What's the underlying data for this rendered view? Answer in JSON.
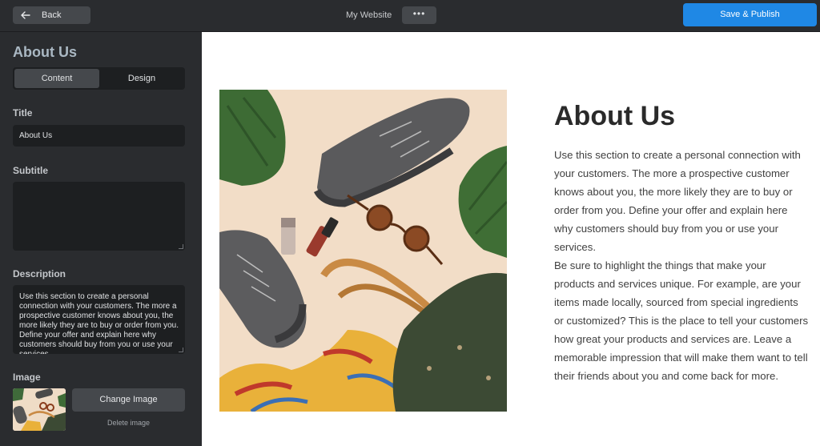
{
  "topbar": {
    "back_label": "Back",
    "site_title": "My Website",
    "more_glyph": "•••",
    "publish_label": "Save & Publish"
  },
  "sidebar": {
    "title": "About Us",
    "tabs": [
      {
        "label": "Content",
        "active": true
      },
      {
        "label": "Design",
        "active": false
      }
    ],
    "title_field": {
      "label": "Title",
      "value": "About Us"
    },
    "subtitle_field": {
      "label": "Subtitle",
      "value": ""
    },
    "description_field": {
      "label": "Description",
      "value": "Use this section to create a personal connection with your customers. The more a prospective customer knows about you, the more likely they are to buy or order from you. Define your offer and explain here why customers should buy from you or use your services."
    },
    "image_field": {
      "label": "Image",
      "change_label": "Change Image",
      "delete_label": "Delete image"
    }
  },
  "preview": {
    "heading": "About Us",
    "paragraphs": [
      "Use this section to create a personal connection with your customers. The more a prospective customer knows about you, the more likely they are to buy or order from you. Define your offer and explain here why customers should buy from you or use your services.",
      "Be sure to highlight the things that make your products and services unique. For example, are your items made locally, sourced from special ingredients or customized? This is the place to tell your customers how great your products and services are. Leave a memorable impression that will make them want to tell their friends about you and come back for more."
    ]
  },
  "icons": {
    "back": "arrow-left-icon",
    "more": "more-dots-icon"
  },
  "colors": {
    "topbar_bg": "#2a2c2f",
    "publish_accent": "#1f88e5",
    "photo_bg": "#f2ddc7"
  }
}
